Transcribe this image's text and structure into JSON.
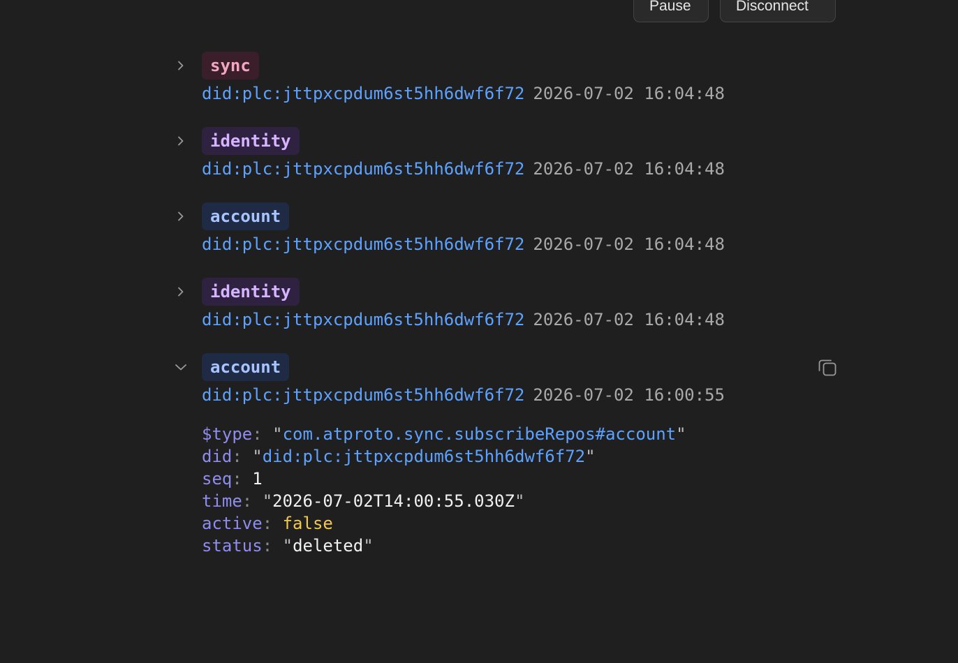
{
  "toolbar": {
    "pause_label": "Pause",
    "disconnect_label": "Disconnect"
  },
  "events": [
    {
      "type": "sync",
      "did": "did:plc:jttpxcpdum6st5hh6dwf6f72",
      "time": "2026-07-02 16:04:48",
      "expanded": false
    },
    {
      "type": "identity",
      "did": "did:plc:jttpxcpdum6st5hh6dwf6f72",
      "time": "2026-07-02 16:04:48",
      "expanded": false
    },
    {
      "type": "account",
      "did": "did:plc:jttpxcpdum6st5hh6dwf6f72",
      "time": "2026-07-02 16:04:48",
      "expanded": false
    },
    {
      "type": "identity",
      "did": "did:plc:jttpxcpdum6st5hh6dwf6f72",
      "time": "2026-07-02 16:04:48",
      "expanded": false
    },
    {
      "type": "account",
      "did": "did:plc:jttpxcpdum6st5hh6dwf6f72",
      "time": "2026-07-02 16:00:55",
      "expanded": true
    }
  ],
  "detail": {
    "type_key": "$type",
    "type_value": "com.atproto.sync.subscribeRepos#account",
    "did_key": "did",
    "did_value": "did:plc:jttpxcpdum6st5hh6dwf6f72",
    "seq_key": "seq",
    "seq_value": "1",
    "time_key": "time",
    "time_value": "2026-07-02T14:00:55.030Z",
    "active_key": "active",
    "active_value": "false",
    "status_key": "status",
    "status_value": "deleted"
  },
  "icons": {
    "collapsed": "chevron-right-icon",
    "expanded": "chevron-down-icon",
    "copy": "copy-icon"
  },
  "colors": {
    "background": "#1f1f1f",
    "did": "#5ea2ff",
    "sync_badge": "#3a1f2a",
    "identity_badge": "#2f2140",
    "account_badge": "#1f2a44",
    "json_key": "#8f8cf0",
    "json_bool": "#f2c94c"
  }
}
